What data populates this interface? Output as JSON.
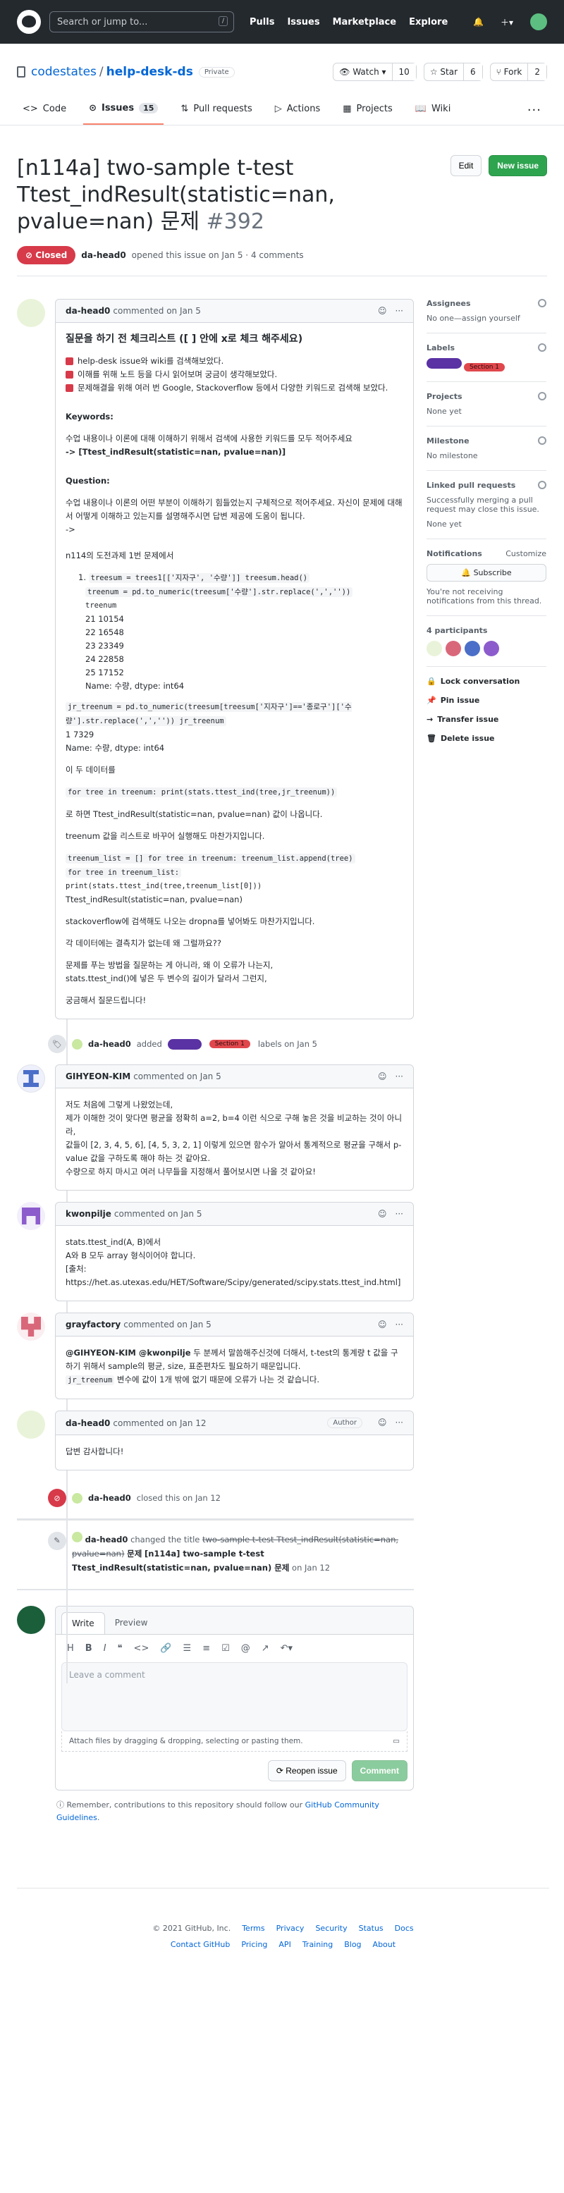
{
  "nav": {
    "search_placeholder": "Search or jump to...",
    "slash": "/",
    "links": [
      "Pulls",
      "Issues",
      "Marketplace",
      "Explore"
    ]
  },
  "repo": {
    "owner": "codestates",
    "name": "help-desk-ds",
    "visibility": "Private",
    "watch": "Watch",
    "watch_count": "10",
    "star": "Star",
    "star_count": "6",
    "fork": "Fork",
    "fork_count": "2"
  },
  "tabs": [
    {
      "label": "Code"
    },
    {
      "label": "Issues",
      "count": "15"
    },
    {
      "label": "Pull requests"
    },
    {
      "label": "Actions"
    },
    {
      "label": "Projects"
    },
    {
      "label": "Wiki"
    }
  ],
  "issue": {
    "title": "[n114a] two-sample t-test Ttest_indResult(statistic=nan, pvalue=nan) 문제",
    "number": "#392",
    "status": "Closed",
    "author": "da-head0",
    "meta": "opened this issue on Jan 5 · 4 comments",
    "edit": "Edit",
    "new_issue": "New issue"
  },
  "c1": {
    "author": "da-head0",
    "when": "commented on Jan 5",
    "heading": "질문을 하기 전 체크리스트 ([ ] 안에 x로 체크 해주세요)",
    "checks": [
      "help-desk issue와 wiki를 검색해보았다.",
      "이해를 위해 노트 등을 다시 읽어보며 궁금이 생각해보았다.",
      "문제해결을 위해 여러 번 Google, Stackoverflow 등에서 다양한 키워드로 검색해 보았다."
    ],
    "kw_label": "Keywords:",
    "kw_text": "수업 내용이나 이론에 대해 이해하기 위해서 검색에 사용한 키워드를 모두 적어주세요",
    "kw_value": "-> [Ttest_indResult(statistic=nan, pvalue=nan)]",
    "q_label": "Question:",
    "q_text": "수업 내용이나 이론의 어떤 부분이 이해하기 힘들었는지 구체적으로 적어주세요. 자신이 문제에 대해서 어떻게 이해하고 있는지를 설명해주시면 답변 제공에 도움이 됩니다.",
    "arrow": "->",
    "p1": "n114의 도전과제 1번 문제에서",
    "code1": "treesum = trees1[['지자구', '수량']] treesum.head()",
    "code2": "treenum = pd.to_numeric(treesum['수량'].str.replace(',',''))",
    "out1": [
      "treenum",
      "21 10154",
      "22 16548",
      "23 23349",
      "24 22858",
      "25 17152",
      "Name: 수량, dtype: int64"
    ],
    "code3": "jr_treenum = pd.to_numeric(treesum[treesum['지자구']=='종로구']['수량'].str.replace(',','')) jr_treenum",
    "out2": [
      "1 7329",
      "Name: 수량, dtype: int64"
    ],
    "p2": "이 두 데이터를",
    "code4": "for tree in treenum: print(stats.ttest_ind(tree,jr_treenum))",
    "p3": "로 하면 Ttest_indResult(statistic=nan, pvalue=nan) 값이 나옵니다.",
    "p4": "treenum 값을 리스트로 바꾸어 실행해도 마찬가지입니다.",
    "code5": "treenum_list = [] for tree in treenum: treenum_list.append(tree)",
    "code6": "for tree in treenum_list:",
    "code7": "print(stats.ttest_ind(tree,treenum_list[0]))",
    "out3": "Ttest_indResult(statistic=nan, pvalue=nan)",
    "p5": "stackoverflow에 검색해도 나오는 dropna를 넣어봐도 마찬가지입니다.",
    "p6": "각 데이터에는 결측치가 없는데 왜 그럴까요??",
    "p7a": "문제를 푸는 방법을 질문하는 게 아니라, 왜 이 오류가 나는지,",
    "p7b": "stats.ttest_ind()에 넣은 두 변수의 길이가 달라서 그런지,",
    "p8": "궁금해서 질문드립니다!"
  },
  "ev_label": {
    "author": "da-head0",
    "action": "added",
    "labels_text": "labels on Jan 5",
    "label2": "Section 1"
  },
  "c2": {
    "author": "GIHYEON-KIM",
    "when": "commented on Jan 5",
    "lines": [
      "저도 처음에 그렇게 나왔었는데,",
      "제가 이해한 것이 맞다면 평균을 정확히 a=2, b=4 이런 식으로 구해 놓은 것을 비교하는 것이 아니라,",
      "값들이 [2, 3, 4, 5, 6], [4, 5, 3, 2, 1] 이렇게 있으면 함수가 알아서 통계적으로 평균을 구해서 p-value 값을 구하도록 해야 하는 것 같아요.",
      "수량으로 하지 마시고 여러 나무들을 지정해서 풀어보시면 나올 것 같아요!"
    ]
  },
  "c3": {
    "author": "kwonpilje",
    "when": "commented on Jan 5",
    "lines": [
      "stats.ttest_ind(A, B)에서",
      "A와 B 모두 array 형식이어야 합니다.",
      "[출처:"
    ],
    "link": "https://het.as.utexas.edu/HET/Software/Scipy/generated/scipy.stats.ttest_ind.html",
    "close": "]"
  },
  "c4": {
    "author": "grayfactory",
    "when": "commented on Jan 5",
    "mentions": "@GIHYEON-KIM @kwonpilje",
    "text1": " 두 분께서 말씀해주신것에 더해서, t-test의 통계량 t 값을 구하기 위해서 sample의 평균, size, 표준편차도 필요하기 때문입니다.",
    "code": "jr_treenum",
    "text2": " 변수에 값이 1개 밖에 없기 때문에 오류가 나는 것 같습니다."
  },
  "c5": {
    "author": "da-head0",
    "when": "commented on Jan 12",
    "tag": "Author",
    "text": "답변 감사합니다!"
  },
  "ev_closed": {
    "author": "da-head0",
    "text": "closed this on Jan 12"
  },
  "ev_renamed": {
    "author": "da-head0",
    "action": "changed the title",
    "old": "two-sample t-test Ttest_indResult(statistic=nan, pvalue=nan)",
    "mid": "문제",
    "new": "[n114a] two-sample t-test Ttest_indResult(statistic=nan, pvalue=nan) 문제",
    "when": "on Jan 12"
  },
  "compose": {
    "write": "Write",
    "preview": "Preview",
    "placeholder": "Leave a comment",
    "attach": "Attach files by dragging & dropping, selecting or pasting them.",
    "reopen": "Reopen issue",
    "comment": "Comment",
    "remember": "Remember, contributions to this repository should follow our",
    "guidelines": "GitHub Community Guidelines",
    "dot": "."
  },
  "sidebar": {
    "assignees": "Assignees",
    "assignees_val": "No one—assign yourself",
    "labels": "Labels",
    "label2": "Section 1",
    "projects": "Projects",
    "projects_val": "None yet",
    "milestone": "Milestone",
    "milestone_val": "No milestone",
    "linked": "Linked pull requests",
    "linked_desc": "Successfully merging a pull request may close this issue.",
    "linked_val": "None yet",
    "notifications": "Notifications",
    "customize": "Customize",
    "subscribe": "Subscribe",
    "notif_desc": "You're not receiving notifications from this thread.",
    "participants": "4 participants",
    "lock": "Lock conversation",
    "pin": "Pin issue",
    "transfer": "Transfer issue",
    "delete": "Delete issue"
  },
  "footer": {
    "copy": "© 2021 GitHub, Inc.",
    "links1": [
      "Terms",
      "Privacy",
      "Security",
      "Status",
      "Docs"
    ],
    "links2": [
      "Contact GitHub",
      "Pricing",
      "API",
      "Training",
      "Blog",
      "About"
    ]
  },
  "colors": {
    "accent": "#0366d6",
    "closed": "#d73a49",
    "green": "#2ea44f",
    "label_purple": "#5a32a3",
    "label_red": "#e0474c"
  }
}
